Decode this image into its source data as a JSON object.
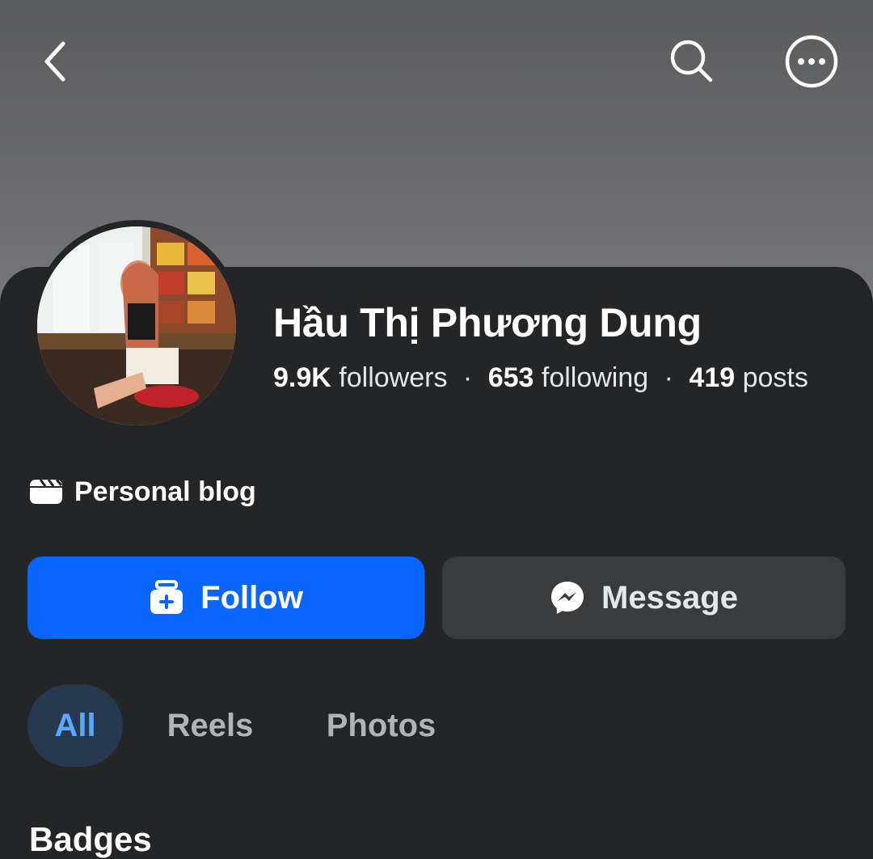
{
  "profile": {
    "name": "Hầu Thị Phương Dung",
    "followers_count": "9.9K",
    "followers_label": "followers",
    "following_count": "653",
    "following_label": "following",
    "posts_count": "419",
    "posts_label": "posts",
    "separator": "·",
    "category": "Personal blog"
  },
  "actions": {
    "follow_label": "Follow",
    "message_label": "Message"
  },
  "tabs": [
    {
      "label": "All",
      "active": true
    },
    {
      "label": "Reels",
      "active": false
    },
    {
      "label": "Photos",
      "active": false
    }
  ],
  "section_title": "Badges",
  "icons": {
    "back": "chevron-left-icon",
    "search": "search-icon",
    "more": "more-options-icon",
    "category": "clapperboard-icon",
    "follow": "add-follow-icon",
    "message": "messenger-icon"
  },
  "colors": {
    "accent": "#0866ff",
    "active_tab_text": "#5aa7ff",
    "active_tab_bg": "#263951",
    "background": "#242526",
    "secondary_button": "#3a3b3c"
  }
}
